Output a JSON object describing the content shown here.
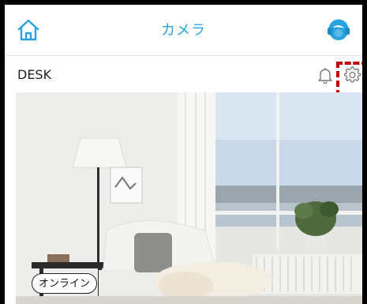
{
  "header": {
    "title": "カメラ",
    "home_icon": "home-icon",
    "support_icon": "support-headset-icon"
  },
  "camera": {
    "name": "DESK",
    "status": "オンライン",
    "alarm_icon": "bell-icon",
    "settings_icon": "gear-icon"
  },
  "colors": {
    "accent": "#29a3e0",
    "highlight": "#c40000"
  }
}
